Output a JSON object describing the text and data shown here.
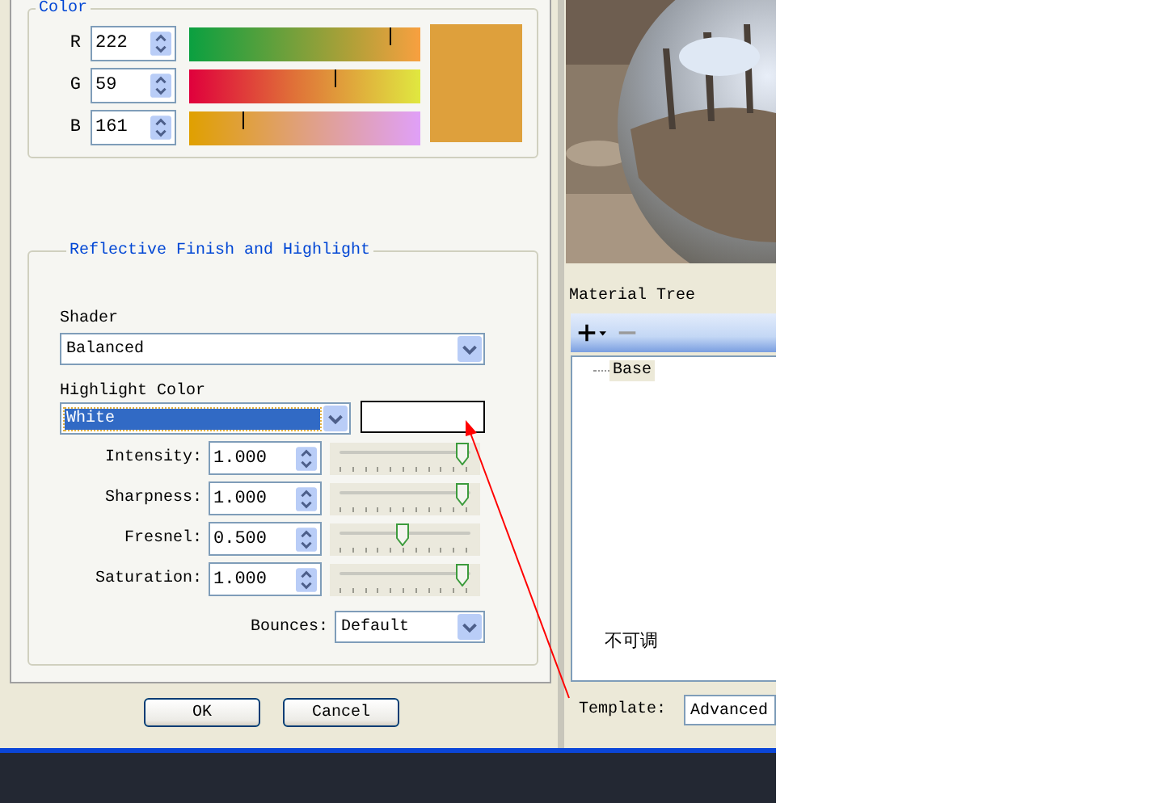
{
  "color_group": {
    "title": "Color",
    "channels": [
      {
        "name": "R",
        "value": "222",
        "level": 0.87
      },
      {
        "name": "G",
        "value": "59",
        "level": 0.63
      },
      {
        "name": "B",
        "value": "161",
        "level": 0.23
      }
    ],
    "preview": {
      "color": "#dea03c"
    }
  },
  "reflective_group": {
    "title": "Reflective Finish and Highlight",
    "shader": {
      "label": "Shader",
      "value": "Balanced"
    },
    "highlight": {
      "label": "Highlight Color",
      "value": "White",
      "focused": true,
      "swatch": {
        "color": "#ffffff"
      }
    },
    "params": [
      {
        "label": "Intensity:",
        "value": "1.000",
        "level": 1.0
      },
      {
        "label": "Sharpness:",
        "value": "1.000",
        "level": 1.0
      },
      {
        "label": "Fresnel:",
        "value": "0.500",
        "level": 0.5
      },
      {
        "label": "Saturation:",
        "value": "1.000",
        "level": 1.0
      }
    ],
    "bounces": {
      "label": "Bounces:",
      "value": "Default"
    }
  },
  "buttons": [
    "OK",
    "Cancel"
  ],
  "preview_picture": {
    "kind": "picture"
  },
  "material_tree": {
    "label": "Material Tree",
    "toolbar": [
      {
        "kind": "add",
        "disabled": false
      },
      {
        "kind": "remove",
        "disabled": true
      }
    ],
    "items": [
      {
        "label": "Base",
        "selected": true
      }
    ]
  },
  "annotation": {
    "text": "不可调"
  },
  "template": {
    "label": "Template:",
    "value": "Advanced"
  }
}
